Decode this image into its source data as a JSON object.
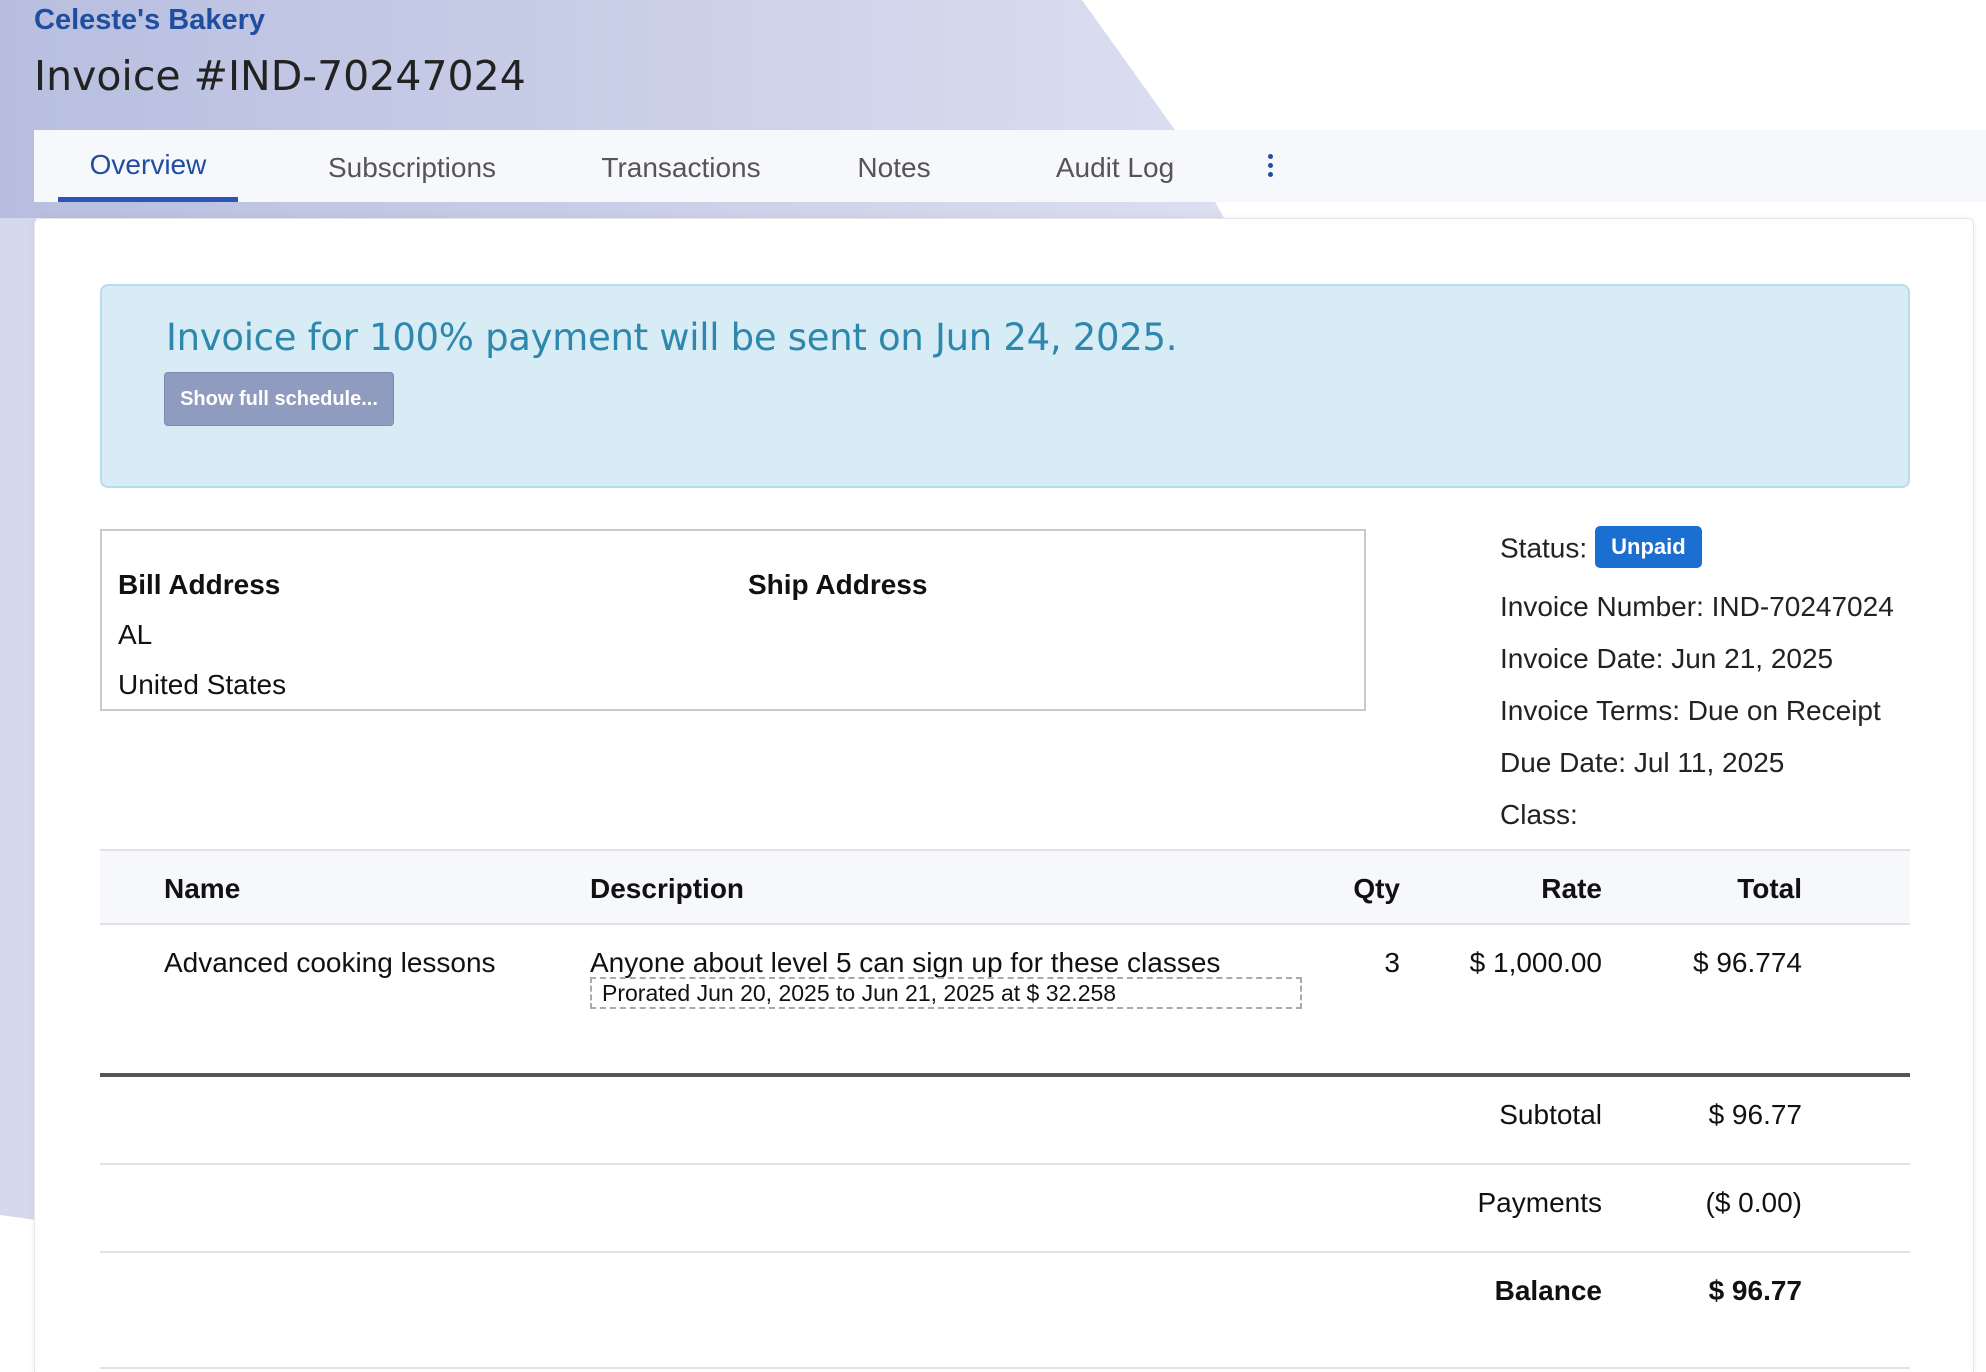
{
  "header": {
    "company": "Celeste's Bakery",
    "invoice_title": "Invoice #IND-70247024"
  },
  "tabs": [
    {
      "label": "Overview",
      "active": true
    },
    {
      "label": "Subscriptions"
    },
    {
      "label": "Transactions"
    },
    {
      "label": "Notes"
    },
    {
      "label": "Audit Log"
    }
  ],
  "notice": {
    "text": "Invoice for 100% payment will be sent on Jun 24, 2025.",
    "button_label": "Show full schedule..."
  },
  "address": {
    "bill_heading": "Bill Address",
    "ship_heading": "Ship Address",
    "bill_lines": [
      "AL",
      "United States"
    ]
  },
  "meta": {
    "status_label": "Status:",
    "status_value": "Unpaid",
    "invoice_number": "Invoice Number: IND-70247024",
    "invoice_date": "Invoice Date: Jun 21, 2025",
    "invoice_terms": "Invoice Terms: Due on Receipt",
    "due_date": "Due Date: Jul 11, 2025",
    "class": "Class:"
  },
  "table": {
    "columns": [
      "Name",
      "Description",
      "Qty",
      "Rate",
      "Total"
    ],
    "rows": [
      {
        "name": "Advanced cooking lessons",
        "description": "Anyone about level 5 can sign up for these classes",
        "proration": "Prorated Jun 20, 2025 to Jun 21, 2025 at $ 32.258",
        "qty": "3",
        "rate": "$ 1,000.00",
        "total": "$ 96.774"
      }
    ]
  },
  "totals": {
    "subtotal_label": "Subtotal",
    "subtotal_value": "$ 96.77",
    "payments_label": "Payments",
    "payments_value": "($ 0.00)",
    "balance_label": "Balance",
    "balance_value": "$ 96.77"
  },
  "colors": {
    "brand": "#1f4da0",
    "status_badge": "#1a6fd0",
    "notice_bg": "#d8ecf5",
    "notice_text": "#2e87ad"
  }
}
